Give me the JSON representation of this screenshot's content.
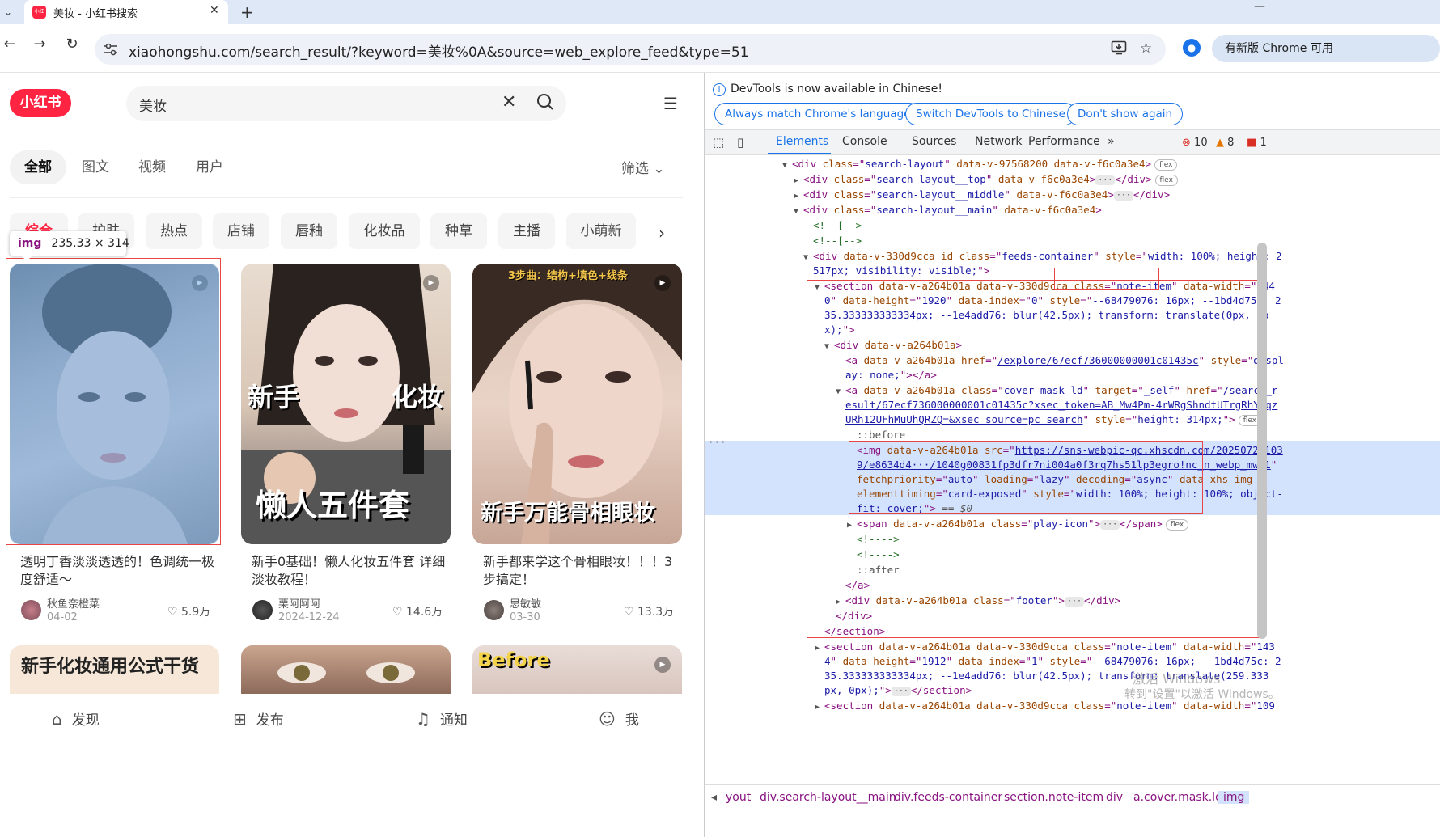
{
  "browser": {
    "tab_title": "美妆 - 小红书搜索",
    "tab_favicon_text": "小红书",
    "url": "xiaohongshu.com/search_result/?keyword=美妆%0A&source=web_explore_feed&type=51",
    "update_label": "有新版 Chrome 可用"
  },
  "page": {
    "logo": "小红书",
    "search_value": "美妆",
    "type_tabs": [
      "全部",
      "图文",
      "视频",
      "用户"
    ],
    "filter_label": "筛选",
    "chips": [
      "综合",
      "护肤",
      "热点",
      "店铺",
      "唇釉",
      "化妆品",
      "种草",
      "主播",
      "小萌新"
    ],
    "img_tooltip": {
      "tag": "img",
      "size": "235.33 × 314"
    },
    "cards": [
      {
        "title": "透明丁香淡淡透透的！色调统一极度舒适～",
        "author": "秋鱼奈橙菜",
        "date": "04-02",
        "likes": "5.9万"
      },
      {
        "title": "新手0基础！懒人化妆五件套 详细淡妆教程！",
        "author": "栗阿阿阿",
        "date": "2024-12-24",
        "likes": "14.6万",
        "overlay_left": "新手",
        "overlay_right": "化妆",
        "overlay_bottom": "懒人五件套"
      },
      {
        "title": "新手都来学这个骨相眼妆！！！3步搞定！",
        "author": "思敏敏",
        "date": "03-30",
        "likes": "13.3万",
        "overlay_top": "3步曲：结构+填色+线条",
        "overlay_bottom": "新手万能骨相眼妆"
      }
    ],
    "bottom_covers": [
      "新手化妆通用公式干货",
      "",
      "Before"
    ],
    "bottom_nav": [
      "发现",
      "发布",
      "通知",
      "我"
    ]
  },
  "devtools": {
    "banner": "DevTools is now available in Chinese!",
    "banner_buttons": [
      "Always match Chrome's language",
      "Switch DevTools to Chinese",
      "Don't show again"
    ],
    "tabs": [
      "Elements",
      "Console",
      "Sources",
      "Network",
      "Performance"
    ],
    "errors": "10",
    "warnings": "8",
    "issues": "1",
    "breadcrumbs": [
      "yout",
      "div.search-layout__main",
      "div.feeds-container",
      "section.note-item",
      "div",
      "a.cover.mask.ld",
      "img"
    ],
    "console_ref": "== $0",
    "colors": {
      "accent": "#1a73e8",
      "xhs_red": "#ff2442",
      "selection": "#d3e3fd"
    }
  },
  "watermark": {
    "line1": "激活 Windows",
    "line2": "转到\"设置\"以激活 Windows。"
  }
}
